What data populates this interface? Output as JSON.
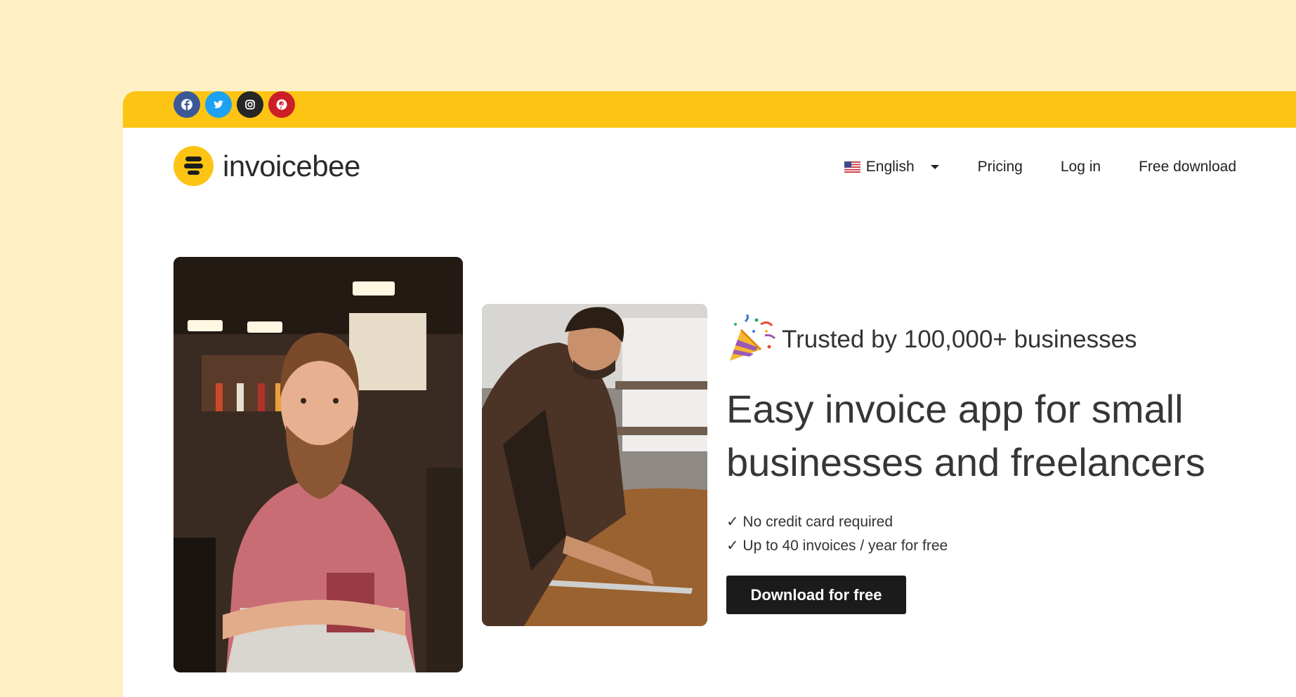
{
  "topbar": {
    "socials": [
      {
        "icon": "facebook-icon",
        "color": "#3b5998"
      },
      {
        "icon": "twitter-icon",
        "color": "#1da1f2"
      },
      {
        "icon": "instagram-icon",
        "color": "#262626"
      },
      {
        "icon": "pinterest-icon",
        "color": "#cb1f27"
      }
    ]
  },
  "header": {
    "logo_text": "invoicebee",
    "nav": {
      "language": "English",
      "pricing": "Pricing",
      "login": "Log in",
      "free_download": "Free download"
    }
  },
  "hero": {
    "trusted": "Trusted by 100,000+ businesses",
    "headline": "Easy invoice app for small businesses and freelancers",
    "checks": [
      "✓ No credit card required",
      "✓ Up to 40 invoices / year for free"
    ],
    "cta": "Download for free"
  },
  "colors": {
    "page_bg": "#fff0c4",
    "topbar": "#fdc414",
    "brand_yellow": "#fdc414",
    "cta_bg": "#1b1b1b"
  }
}
